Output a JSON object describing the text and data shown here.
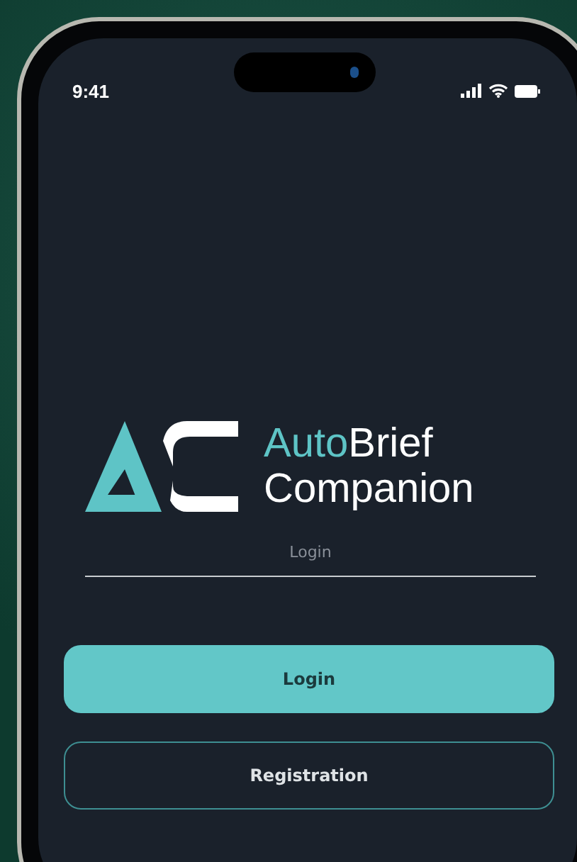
{
  "status_bar": {
    "time": "9:41"
  },
  "app_name": {
    "accent": "Auto",
    "main": "Brief",
    "line2": "Companion"
  },
  "login_field": {
    "placeholder": "Login"
  },
  "buttons": [
    {
      "label": "Login",
      "kind": "primary"
    },
    {
      "label": "Registration",
      "kind": "outline"
    }
  ]
}
